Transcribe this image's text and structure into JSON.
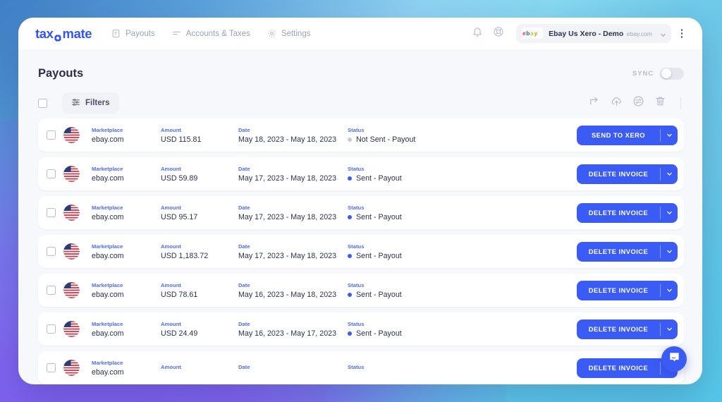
{
  "brand": {
    "logo_text_before": "tax",
    "logo_gear": "gear-o",
    "logo_text_after": "mate"
  },
  "nav": {
    "items": [
      {
        "label": "Payouts",
        "icon": "clipboard-icon"
      },
      {
        "label": "Accounts & Taxes",
        "icon": "lines-icon"
      },
      {
        "label": "Settings",
        "icon": "gear-icon"
      }
    ]
  },
  "account": {
    "badge": "ebay-logo",
    "name": "Ebay Us Xero - Demo",
    "domain": "ebay.com",
    "bell_icon": "bell-icon",
    "help_icon": "lifebuoy-icon",
    "kebab_icon": "kebab-menu-icon"
  },
  "page": {
    "title": "Payouts",
    "sync_label": "SYNC",
    "sync_on": false
  },
  "toolbar": {
    "filters_label": "Filters",
    "filters_icon": "sliders-icon",
    "actions": [
      {
        "icon": "share-arrow-icon"
      },
      {
        "icon": "cloud-upload-icon"
      },
      {
        "icon": "refresh-circle-icon"
      },
      {
        "icon": "trash-icon"
      }
    ]
  },
  "table": {
    "labels": {
      "marketplace": "Marketplace",
      "amount": "Amount",
      "date": "Date",
      "status": "Status"
    },
    "rows": [
      {
        "marketplace": "ebay.com",
        "flag": "us-flag-icon",
        "amount": "USD 115.81",
        "date": "May 18, 2023 - May 18, 2023",
        "status": "Not Sent  - Payout",
        "status_color": "#c6cad8",
        "action": "SEND TO XERO"
      },
      {
        "marketplace": "ebay.com",
        "flag": "us-flag-icon",
        "amount": "USD 59.89",
        "date": "May 17, 2023 - May 18, 2023",
        "status": "Sent  - Payout",
        "status_color": "#3b5bf5",
        "action": "DELETE INVOICE"
      },
      {
        "marketplace": "ebay.com",
        "flag": "us-flag-icon",
        "amount": "USD 95.17",
        "date": "May 17, 2023 - May 18, 2023",
        "status": "Sent  - Payout",
        "status_color": "#3b5bf5",
        "action": "DELETE INVOICE"
      },
      {
        "marketplace": "ebay.com",
        "flag": "us-flag-icon",
        "amount": "USD 1,183.72",
        "date": "May 17, 2023 - May 18, 2023",
        "status": "Sent  - Payout",
        "status_color": "#3b5bf5",
        "action": "DELETE INVOICE"
      },
      {
        "marketplace": "ebay.com",
        "flag": "us-flag-icon",
        "amount": "USD 78.61",
        "date": "May 16, 2023 - May 18, 2023",
        "status": "Sent  - Payout",
        "status_color": "#3b5bf5",
        "action": "DELETE INVOICE"
      },
      {
        "marketplace": "ebay.com",
        "flag": "us-flag-icon",
        "amount": "USD 24.49",
        "date": "May 16, 2023 - May 17, 2023",
        "status": "Sent  - Payout",
        "status_color": "#3b5bf5",
        "action": "DELETE INVOICE"
      },
      {
        "marketplace": "ebay.com",
        "flag": "us-flag-icon",
        "amount": "",
        "date": "",
        "status": "",
        "status_color": "#3b5bf5",
        "action": "DELETE INVOICE"
      }
    ]
  },
  "chat": {
    "icon": "chat-bubble-icon"
  },
  "colors": {
    "accent": "#3b5bf5",
    "label_blue": "#4f6bf0",
    "text_dark": "#2c3150",
    "muted": "#9aa2b8"
  }
}
